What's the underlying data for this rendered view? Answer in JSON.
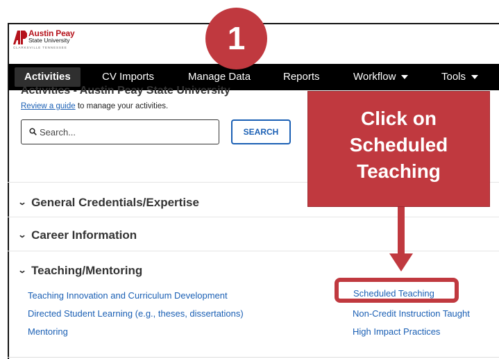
{
  "logo": {
    "mark": "AP",
    "name": "Austin Peay",
    "sub": "State University",
    "location": "CLARKSVILLE TENNESSEE"
  },
  "step_badge": "1",
  "nav": {
    "items": [
      {
        "label": "Activities"
      },
      {
        "label": "CV Imports"
      },
      {
        "label": "Manage Data"
      },
      {
        "label": "Reports"
      },
      {
        "label": "Workflow"
      },
      {
        "label": "Tools"
      }
    ]
  },
  "header": {
    "title": "Activities - Austin Peay State University",
    "guide_link": "Review a guide",
    "guide_rest": " to manage your activities."
  },
  "search": {
    "placeholder": "Search...",
    "button": "SEARCH"
  },
  "sections": [
    {
      "label": "General Credentials/Expertise"
    },
    {
      "label": "Career Information"
    },
    {
      "label": "Teaching/Mentoring"
    }
  ],
  "teaching_links": {
    "left": [
      "Teaching Innovation and Curriculum Development",
      "Directed Student Learning (e.g., theses, dissertations)",
      "Mentoring"
    ],
    "right": [
      "Scheduled Teaching",
      "Non-Credit Instruction Taught",
      "High Impact Practices"
    ]
  },
  "callout": {
    "line1": "Click on",
    "line2": "Scheduled",
    "line3": "Teaching"
  },
  "colors": {
    "accent": "#c0393f",
    "link": "#1a5fb4",
    "nav_bg": "#000000"
  }
}
